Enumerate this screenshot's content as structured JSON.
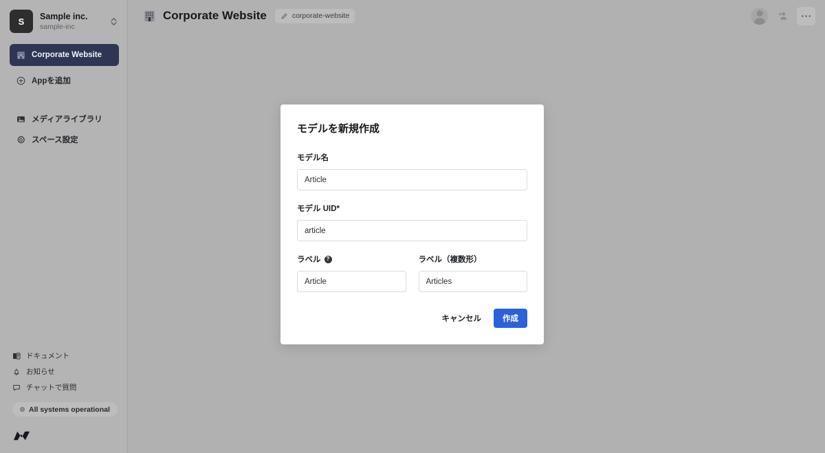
{
  "sidebar": {
    "org": {
      "avatar_letter": "S",
      "name": "Sample inc.",
      "slug": "sample-inc",
      "switch_icon": "selector-up-down-icon"
    },
    "apps": [
      {
        "label": "Corporate Website",
        "icon": "office-building-icon",
        "active": true
      }
    ],
    "add_app": {
      "label": "Appを追加",
      "icon": "plus-circle-icon"
    },
    "nav": [
      {
        "label": "メディアライブラリ",
        "icon": "image-icon"
      },
      {
        "label": "スペース設定",
        "icon": "gear-icon"
      }
    ],
    "footer_links": [
      {
        "label": "ドキュメント",
        "icon": "book-icon"
      },
      {
        "label": "お知らせ",
        "icon": "bell-icon"
      },
      {
        "label": "チャットで質問",
        "icon": "chat-bubble-icon"
      }
    ],
    "status": {
      "label": "All systems operational",
      "dot_color": "#8d9096"
    },
    "brand_logo": "newt-logo-icon"
  },
  "header": {
    "app_icon": "office-building-icon",
    "title": "Corporate Website",
    "uid_badge": {
      "icon": "pencil-icon",
      "text": "corporate-website"
    },
    "actions": [
      {
        "name": "user-avatar",
        "icon": "avatar-icon"
      },
      {
        "name": "invite-member",
        "icon": "add-person-icon"
      },
      {
        "name": "more-options",
        "icon": "ellipsis-icon"
      }
    ]
  },
  "modal": {
    "title": "モデルを新規作成",
    "fields": {
      "model_name": {
        "label": "モデル名",
        "value": "Article",
        "placeholder": ""
      },
      "model_uid": {
        "label": "モデル UID*",
        "value": "article",
        "placeholder": ""
      },
      "label_singular": {
        "label": "ラベル",
        "value": "Article",
        "placeholder": "",
        "help_icon": "question-mark-icon"
      },
      "label_plural": {
        "label": "ラベル（複数形）",
        "value": "Articles",
        "placeholder": ""
      }
    },
    "cancel_label": "キャンセル",
    "create_label": "作成",
    "accent_color": "#2b62d9"
  }
}
